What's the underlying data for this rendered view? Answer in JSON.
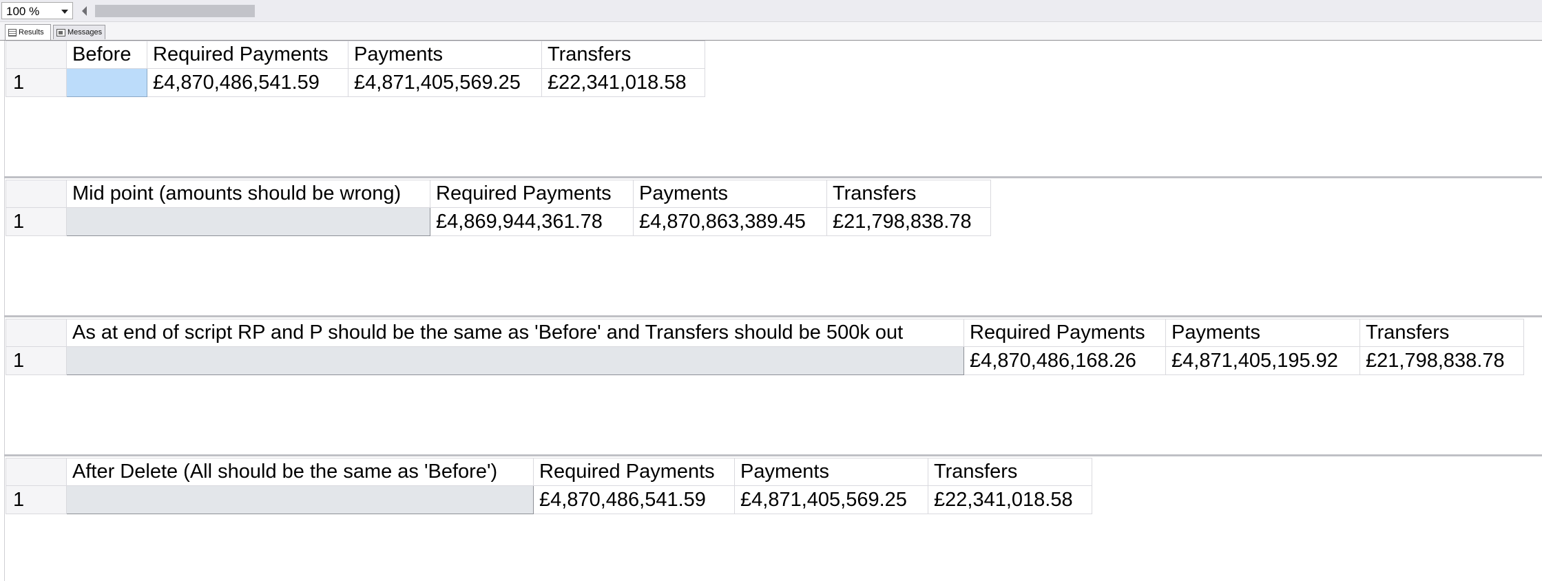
{
  "toolbar": {
    "zoom_value": "100 %"
  },
  "tabs": [
    {
      "label": "Results",
      "icon": "grid-icon",
      "active": true
    },
    {
      "label": "Messages",
      "icon": "messages-icon",
      "active": false
    }
  ],
  "result_sets": [
    {
      "headers": [
        "Before",
        "Required Payments",
        "Payments",
        "Transfers"
      ],
      "row_number": "1",
      "cells": [
        "",
        "£4,870,486,541.59",
        "£4,871,405,569.25",
        "£22,341,018.58"
      ]
    },
    {
      "headers": [
        "Mid point (amounts should be wrong)",
        "Required Payments",
        "Payments",
        "Transfers"
      ],
      "row_number": "1",
      "cells": [
        "",
        "£4,869,944,361.78",
        "£4,870,863,389.45",
        "£21,798,838.78"
      ]
    },
    {
      "headers": [
        "As at end of script RP and P should be the same as 'Before' and Transfers should be 500k out",
        "Required Payments",
        "Payments",
        "Transfers"
      ],
      "row_number": "1",
      "cells": [
        "",
        "£4,870,486,168.26",
        "£4,871,405,195.92",
        "£21,798,838.78"
      ]
    },
    {
      "headers": [
        "After Delete (All should be the same as 'Before')",
        "Required Payments",
        "Payments",
        "Transfers"
      ],
      "row_number": "1",
      "cells": [
        "",
        "£4,870,486,541.59",
        "£4,871,405,569.25",
        "£22,341,018.58"
      ]
    }
  ],
  "colors": {
    "selected_cell": "#bcdcfa",
    "empty_cell": "#e3e6ea",
    "divider": "#bfc0c5"
  }
}
